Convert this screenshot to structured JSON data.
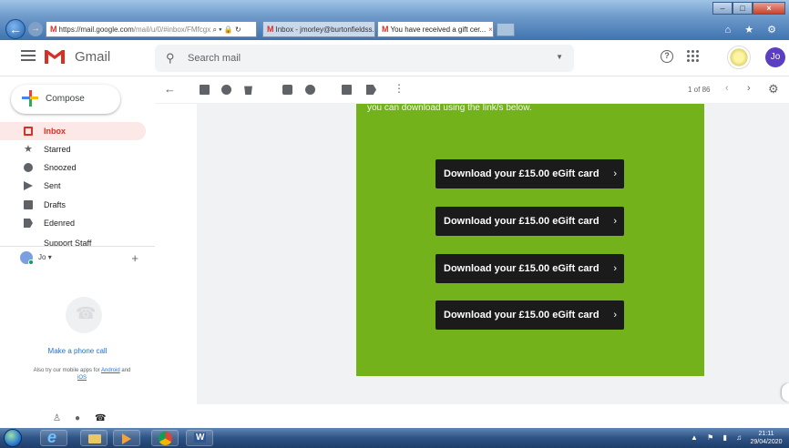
{
  "browser": {
    "address": "https://mail.google.com/mail/u/0/#inbox/FMfcgx",
    "address_visible": "https://",
    "address_host": "mail.google.com",
    "address_path": "/mail/u/0/#inbox/FMfcgx",
    "address_icons": "⌕ ▾ 🔒 ↻",
    "tabs": [
      {
        "label": "Inbox - jmorley@burtonfieldss..."
      },
      {
        "label": "You have received a gift cer...",
        "close": "×"
      }
    ],
    "tab_icon": "M",
    "window_buttons": {
      "minimize": "–",
      "maximize": "□",
      "close": "×"
    },
    "toolbar_icons": "⌂ ★ ⚙"
  },
  "gmail": {
    "product_name": "Gmail",
    "search": {
      "placeholder": "Search mail",
      "icon": "search-icon",
      "dropdown": "▼"
    },
    "help": "?",
    "avatar_initials": "Jo",
    "brand_color": "#d93025"
  },
  "sidebar": {
    "compose_label": "Compose",
    "items": [
      {
        "label": "Inbox",
        "icon": "inbox-icon",
        "active": true
      },
      {
        "label": "Starred",
        "icon": "star-icon",
        "glyph": "★"
      },
      {
        "label": "Snoozed",
        "icon": "clock-icon"
      },
      {
        "label": "Sent",
        "icon": "send-icon"
      },
      {
        "label": "Drafts",
        "icon": "draft-icon"
      },
      {
        "label": "Edenred",
        "icon": "label-icon"
      }
    ],
    "partial_item": "Support Staff",
    "hangouts": {
      "user": "Jo",
      "user_caret": "▾",
      "add": "+",
      "make_call": "Make a phone call",
      "also_try_prefix": "Also try our mobile apps for",
      "android": "Android",
      "and": "and",
      "ios": "iOS"
    },
    "bottom_icons": {
      "person": "♙",
      "chat": "●",
      "phone": "☎"
    }
  },
  "toolbar": {
    "back": "←",
    "more": "⋮",
    "count": "1 of 86",
    "prev": "‹",
    "next": "›",
    "settings": "⚙"
  },
  "message": {
    "intro_text": "you can download using the link/s below.",
    "card_color": "#73b21a",
    "buttons": [
      {
        "label": "Download your £15.00 eGift card",
        "chevron": "›"
      },
      {
        "label": "Download your £15.00 eGift card",
        "chevron": "›"
      },
      {
        "label": "Download your £15.00 eGift card",
        "chevron": "›"
      },
      {
        "label": "Download your £15.00 eGift card",
        "chevron": "›"
      }
    ]
  },
  "taskbar": {
    "tray": "▲ ⚑ ▮ ♫",
    "time": "21:11",
    "date": "29/04/2020"
  }
}
